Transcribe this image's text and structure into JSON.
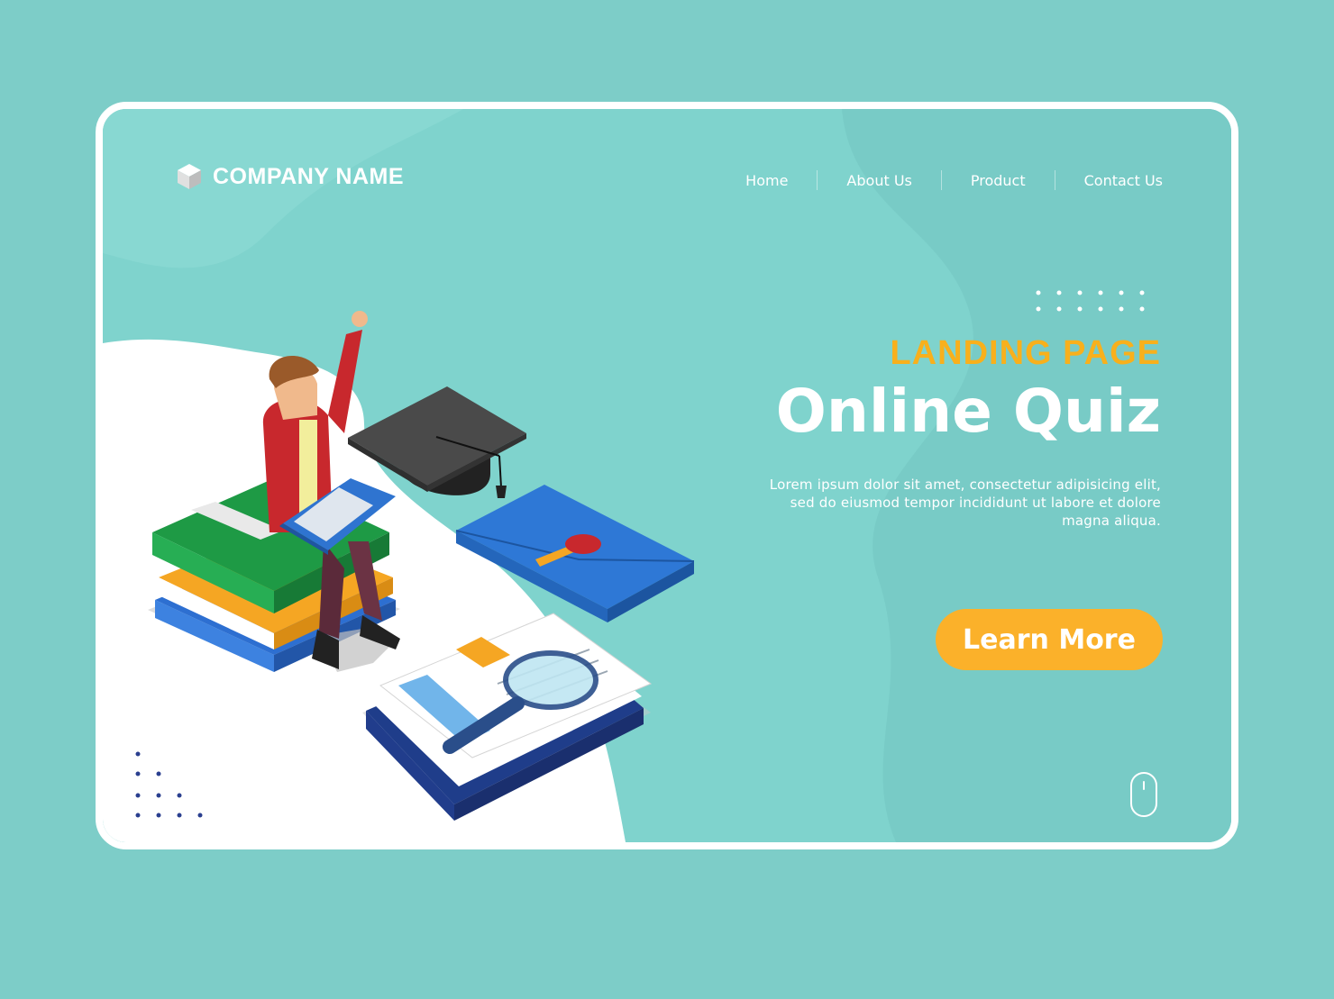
{
  "brand": {
    "name": "COMPANY NAME",
    "logo_icon": "cube-icon"
  },
  "nav": {
    "items": [
      "Home",
      "About Us",
      "Product",
      "Contact Us"
    ]
  },
  "hero": {
    "eyebrow": "LANDING PAGE",
    "title": "Online Quiz",
    "description": "Lorem ipsum dolor sit amet, consectetur adipisicing elit, sed do eiusmod tempor incididunt ut labore et dolore magna aliqua.",
    "cta_label": "Learn More"
  },
  "scroll_indicator": {
    "icon": "mouse-scroll-icon"
  },
  "colors": {
    "background": "#7dcdc8",
    "panel": "#7fd3cd",
    "accent": "#f8b01c",
    "button": "#fbb12a",
    "text": "#ffffff"
  }
}
